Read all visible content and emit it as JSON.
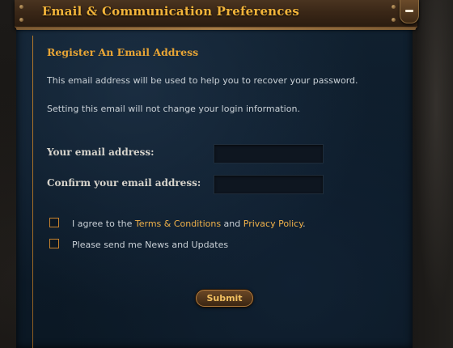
{
  "header": {
    "title": "Email & Communication Preferences",
    "collapse_icon": "minus-icon"
  },
  "form": {
    "section_title": "Register An Email Address",
    "info_line_1": "This email address will be used to help you to recover your password.",
    "info_line_2": "Setting this email will not change your login information.",
    "email_label": "Your email address:",
    "email_value": "",
    "confirm_label": "Confirm your email address:",
    "confirm_value": "",
    "terms": {
      "prefix": "I agree to the ",
      "terms_link": "Terms & Conditions",
      "middle": " and ",
      "privacy_link": "Privacy Policy",
      "suffix": ".",
      "checked": false
    },
    "news": {
      "label": "Please send me News and Updates",
      "checked": false
    },
    "submit_label": "Submit"
  },
  "colors": {
    "accent": "#f0b14a",
    "header_title": "#f2b43a",
    "panel_bg": "#0c1a28",
    "text": "#c9d0d6"
  }
}
